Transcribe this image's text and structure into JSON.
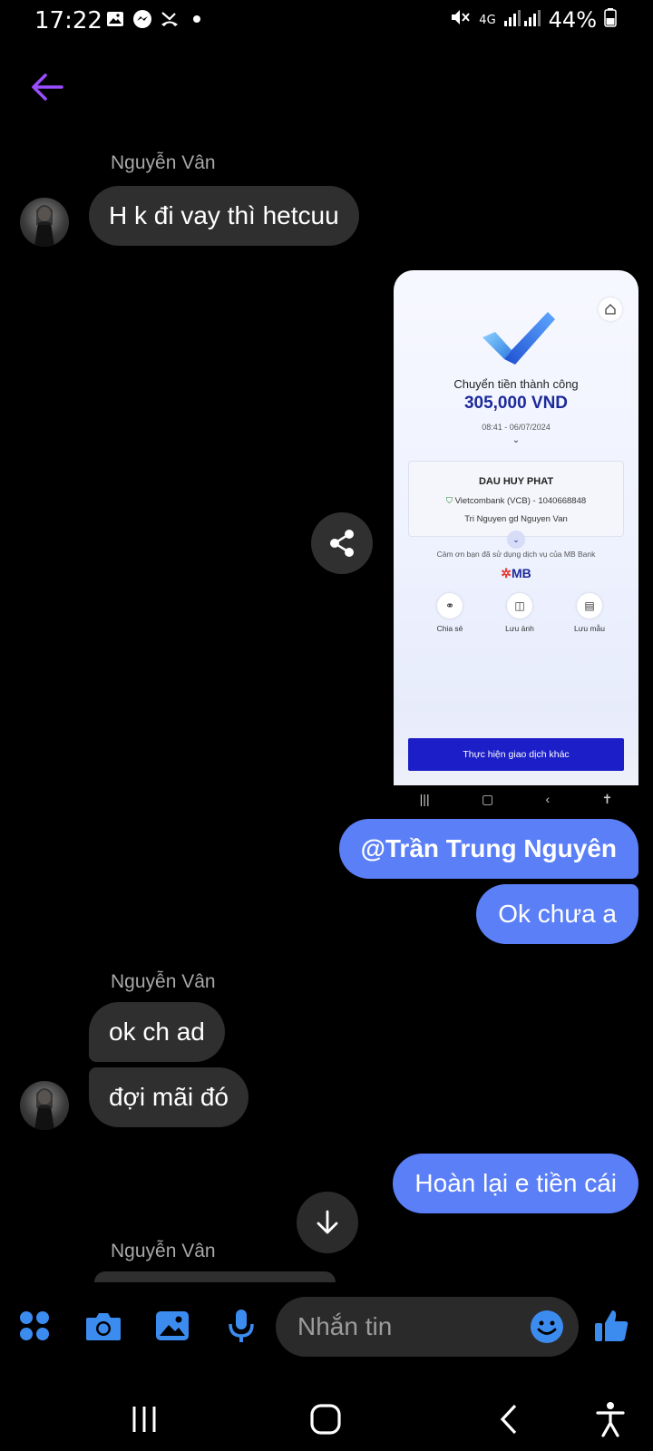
{
  "status_bar": {
    "time": "17:22",
    "network": "4G",
    "battery": "44%",
    "icons_left": [
      "image-icon",
      "messenger-icon",
      "missed-call-icon",
      "dot-icon"
    ]
  },
  "messages": [
    {
      "sender": "Nguyễn Vân",
      "direction": "in",
      "text": "H k đi vay thì hetcuu"
    },
    {
      "direction": "out",
      "type": "image",
      "alt": "bank transfer receipt"
    },
    {
      "direction": "out",
      "text": "@Trần Trung Nguyên"
    },
    {
      "direction": "out",
      "text": "Ok chưa a"
    },
    {
      "sender": "Nguyễn Vân",
      "direction": "in",
      "text": "ok ch ad"
    },
    {
      "direction": "in",
      "text": "đợi mãi đó"
    },
    {
      "direction": "out",
      "text": "Hoàn lại e tiền cái"
    },
    {
      "sender": "Nguyễn Vân",
      "direction": "in",
      "text": ""
    }
  ],
  "receipt": {
    "title": "Chuyển tiền thành công",
    "amount": "305,000 VND",
    "datetime": "08:41 - 06/07/2024",
    "recipient": "DAU HUY PHAT",
    "bank": "Vietcombank (VCB) - 1040668848",
    "note": "Tri Nguyen gd Nguyen Van",
    "thanks": "Cảm ơn bạn đã sử dụng dịch vụ của MB Bank",
    "brand": "MB",
    "actions": [
      "Chia sẻ",
      "Lưu ảnh",
      "Lưu mẫu"
    ],
    "cta": "Thực hiện giao dịch khác"
  },
  "composer": {
    "placeholder": "Nhắn tin"
  },
  "colors": {
    "accent": "#5b7ff7",
    "incoming_bubble": "#2f2f2f",
    "back_arrow": "#9b4dff",
    "icon_blue": "#3c8cf0"
  }
}
